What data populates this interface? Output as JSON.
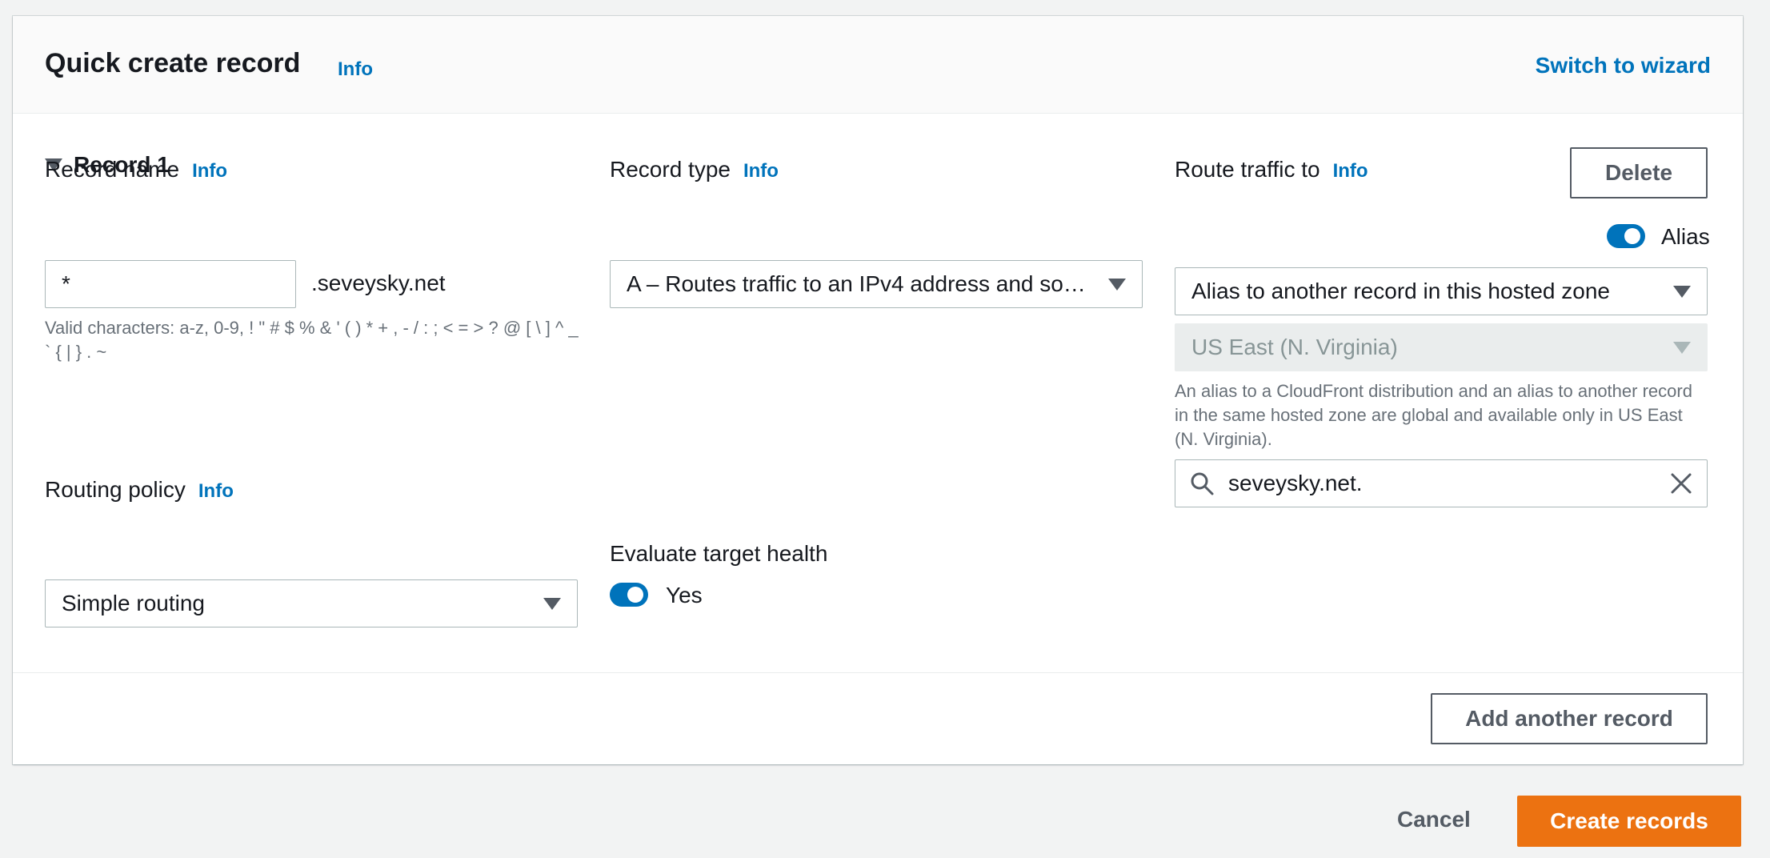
{
  "header": {
    "title": "Quick create record",
    "info": "Info",
    "switch_link": "Switch to wizard"
  },
  "record": {
    "label": "Record 1",
    "delete_label": "Delete"
  },
  "record_name": {
    "label": "Record name",
    "info": "Info",
    "value": "*",
    "suffix": ".seveysky.net",
    "hint": "Valid characters: a-z, 0-9, ! \" # $ % & ' ( ) * + , - / : ; < = > ? @ [ \\ ] ^ _ ` { | } . ~"
  },
  "record_type": {
    "label": "Record type",
    "info": "Info",
    "value": "A – Routes traffic to an IPv4 address and so…"
  },
  "route_traffic": {
    "label": "Route traffic to",
    "info": "Info",
    "alias_label": "Alias",
    "alias_on": true,
    "target_value": "Alias to another record in this hosted zone",
    "region_value": "US East (N. Virginia)",
    "hint": "An alias to a CloudFront distribution and an alias to another record in the same hosted zone are global and available only in US East (N. Virginia).",
    "search_value": "seveysky.net."
  },
  "routing_policy": {
    "label": "Routing policy",
    "info": "Info",
    "value": "Simple routing"
  },
  "evaluate_health": {
    "label": "Evaluate target health",
    "toggle_label": "Yes",
    "on": true
  },
  "footer": {
    "add_label": "Add another record",
    "cancel_label": "Cancel",
    "create_label": "Create records"
  },
  "colors": {
    "accent": "#0073bb",
    "primary_button": "#ec7211"
  },
  "icons": [
    "caret-down-icon",
    "search-icon",
    "close-icon"
  ]
}
